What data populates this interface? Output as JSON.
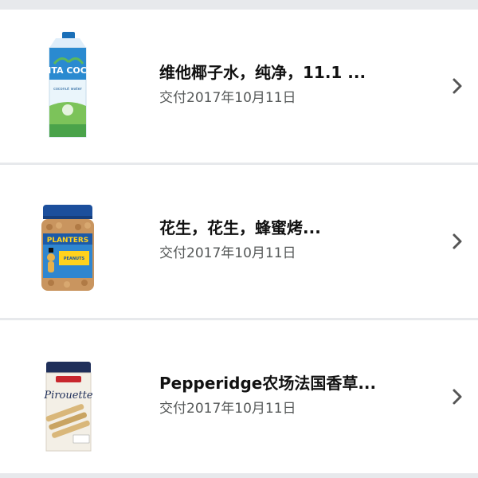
{
  "orders": [
    {
      "title": "维他椰子水，纯净，11.1 ...",
      "date": "交付2017年10月11日",
      "image_icon": "coconut-water-carton",
      "brand_text": "VITA COCO",
      "brand_color": "#1f7fc6"
    },
    {
      "title": "花生，花生，蜂蜜烤...",
      "date": "交付2017年10月11日",
      "image_icon": "peanut-jar",
      "brand_text": "PLANTERS",
      "brand_color": "#1c5aa8"
    },
    {
      "title": "Pepperidge农场法国香草...",
      "date": "交付2017年10月11日",
      "image_icon": "pirouette-tin",
      "brand_text": "Pirouette",
      "brand_color": "#1f2f5a"
    }
  ],
  "chevron_icon": "chevron-right-icon",
  "colors": {
    "background": "#e7e9ec",
    "row": "#ffffff",
    "title": "#111111",
    "date": "#565959",
    "chevron": "#555555"
  }
}
